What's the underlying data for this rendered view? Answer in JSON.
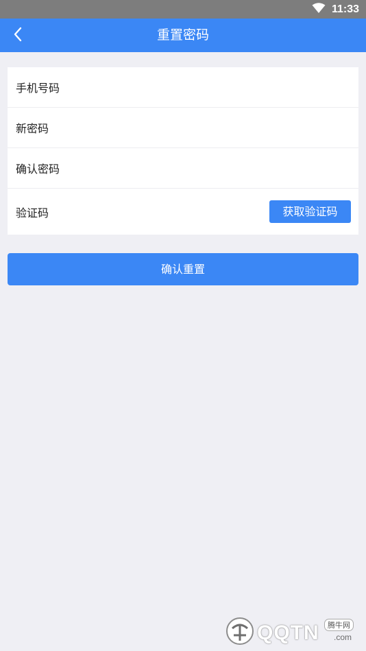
{
  "status_bar": {
    "time": "11:33"
  },
  "nav": {
    "title": "重置密码"
  },
  "form": {
    "phone_label": "手机号码",
    "new_password_label": "新密码",
    "confirm_password_label": "确认密码",
    "code_label": "验证码",
    "get_code_button": "获取验证码"
  },
  "submit_button": "确认重置",
  "watermark": {
    "brand": "QQTN",
    "suffix": ".com",
    "cn_text": "腾牛网"
  },
  "colors": {
    "accent": "#3b87f5",
    "background": "#efeff4",
    "status_bar": "#7d7d7d"
  }
}
